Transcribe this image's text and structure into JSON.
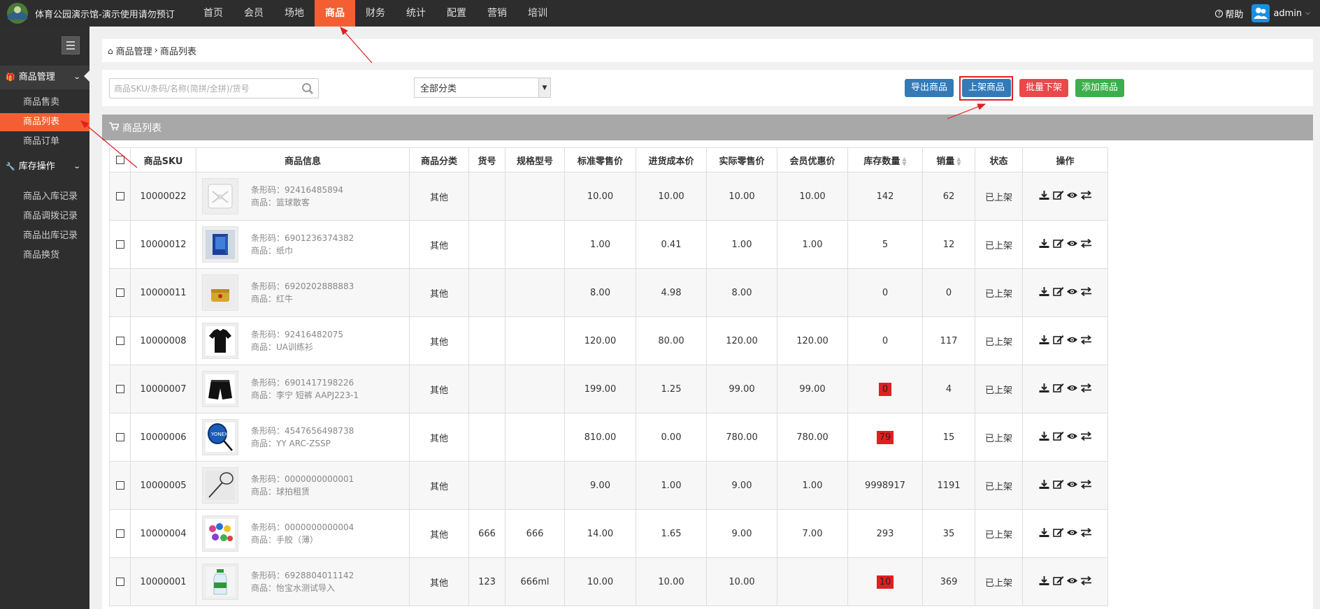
{
  "app": {
    "title": "体育公园演示馆-演示使用请勿预订"
  },
  "nav": [
    "首页",
    "会员",
    "场地",
    "商品",
    "财务",
    "统计",
    "配置",
    "营销",
    "培训"
  ],
  "nav_active": "商品",
  "topright": {
    "help": "帮助",
    "user": "admin"
  },
  "sidebar": {
    "group1": {
      "label": "商品管理",
      "items": [
        "商品售卖",
        "商品列表",
        "商品订单"
      ]
    },
    "group2": {
      "label": "库存操作",
      "items": [
        "商品入库记录",
        "商品调拨记录",
        "商品出库记录",
        "商品换货"
      ]
    },
    "active_item": "商品列表"
  },
  "breadcrumb": {
    "root": "商品管理",
    "sep": "›",
    "current": "商品列表"
  },
  "search": {
    "placeholder": "商品SKU/条码/名称(简拼/全拼)/货号"
  },
  "category_select": {
    "value": "全部分类"
  },
  "buttons": {
    "export": "导出商品",
    "shelve": "上架商品",
    "batch_off": "批量下架",
    "add": "添加商品"
  },
  "panel": {
    "title": "商品列表"
  },
  "table": {
    "columns": [
      "商品SKU",
      "商品信息",
      "商品分类",
      "货号",
      "规格型号",
      "标准零售价",
      "进货成本价",
      "实际零售价",
      "会员优惠价",
      "库存数量",
      "销量",
      "状态",
      "操作"
    ],
    "barcode_label": "条形码：",
    "name_label": "商品：",
    "rows": [
      {
        "sku": "10000022",
        "barcode": "92416485894",
        "name": "篮球散客",
        "category": "其他",
        "item_no": "",
        "spec": "",
        "std_price": "10.00",
        "cost": "10.00",
        "actual": "10.00",
        "member": "10.00",
        "stock": "142",
        "stock_low": false,
        "sales": "62",
        "status": "已上架"
      },
      {
        "sku": "10000012",
        "barcode": "6901236374382",
        "name": "纸巾",
        "category": "其他",
        "item_no": "",
        "spec": "",
        "std_price": "1.00",
        "cost": "0.41",
        "actual": "1.00",
        "member": "1.00",
        "stock": "5",
        "stock_low": false,
        "sales": "12",
        "status": "已上架"
      },
      {
        "sku": "10000011",
        "barcode": "6920202888883",
        "name": "红牛",
        "category": "其他",
        "item_no": "",
        "spec": "",
        "std_price": "8.00",
        "cost": "4.98",
        "actual": "8.00",
        "member": "",
        "stock": "0",
        "stock_low": false,
        "sales": "0",
        "status": "已上架"
      },
      {
        "sku": "10000008",
        "barcode": "92416482075",
        "name": "UA训练衫",
        "category": "其他",
        "item_no": "",
        "spec": "",
        "std_price": "120.00",
        "cost": "80.00",
        "actual": "120.00",
        "member": "120.00",
        "stock": "0",
        "stock_low": false,
        "sales": "117",
        "status": "已上架"
      },
      {
        "sku": "10000007",
        "barcode": "6901417198226",
        "name": "李宁 短裤 AAPJ223-1",
        "category": "其他",
        "item_no": "",
        "spec": "",
        "std_price": "199.00",
        "cost": "1.25",
        "actual": "99.00",
        "member": "99.00",
        "stock": "0",
        "stock_low": true,
        "sales": "4",
        "status": "已上架"
      },
      {
        "sku": "10000006",
        "barcode": "4547656498738",
        "name": "YY ARC-ZSSP",
        "category": "其他",
        "item_no": "",
        "spec": "",
        "std_price": "810.00",
        "cost": "0.00",
        "actual": "780.00",
        "member": "780.00",
        "stock": "79",
        "stock_low": true,
        "sales": "15",
        "status": "已上架"
      },
      {
        "sku": "10000005",
        "barcode": "0000000000001",
        "name": "球拍租赁",
        "category": "其他",
        "item_no": "",
        "spec": "",
        "std_price": "9.00",
        "cost": "1.00",
        "actual": "9.00",
        "member": "1.00",
        "stock": "9998917",
        "stock_low": false,
        "sales": "1191",
        "status": "已上架"
      },
      {
        "sku": "10000004",
        "barcode": "0000000000004",
        "name": "手胶（薄）",
        "category": "其他",
        "item_no": "666",
        "spec": "666",
        "std_price": "14.00",
        "cost": "1.65",
        "actual": "9.00",
        "member": "7.00",
        "stock": "293",
        "stock_low": false,
        "sales": "35",
        "status": "已上架"
      },
      {
        "sku": "10000001",
        "barcode": "6928804011142",
        "name": "怡宝水测试导入",
        "category": "其他",
        "item_no": "123",
        "spec": "666ml",
        "std_price": "10.00",
        "cost": "10.00",
        "actual": "10.00",
        "member": "",
        "stock": "10",
        "stock_low": true,
        "sales": "369",
        "status": "已上架"
      }
    ],
    "row_icons": [
      "download-icon",
      "edit-icon",
      "view-icon",
      "transfer-icon"
    ],
    "thumbs": [
      "basketball-placeholder",
      "tissue-box",
      "red-bull-can",
      "black-shirt",
      "black-shorts",
      "badminton-racket-blue",
      "badminton-racket-white",
      "grip-tapes",
      "water-bottle"
    ]
  },
  "colors": {
    "accent": "#f35f33",
    "topbar": "#2d2d2d",
    "sidebar": "#2e2e2e",
    "primary": "#337ab7",
    "danger": "#e64a4a",
    "success": "#3dae4c",
    "annotation": "#e02020"
  }
}
